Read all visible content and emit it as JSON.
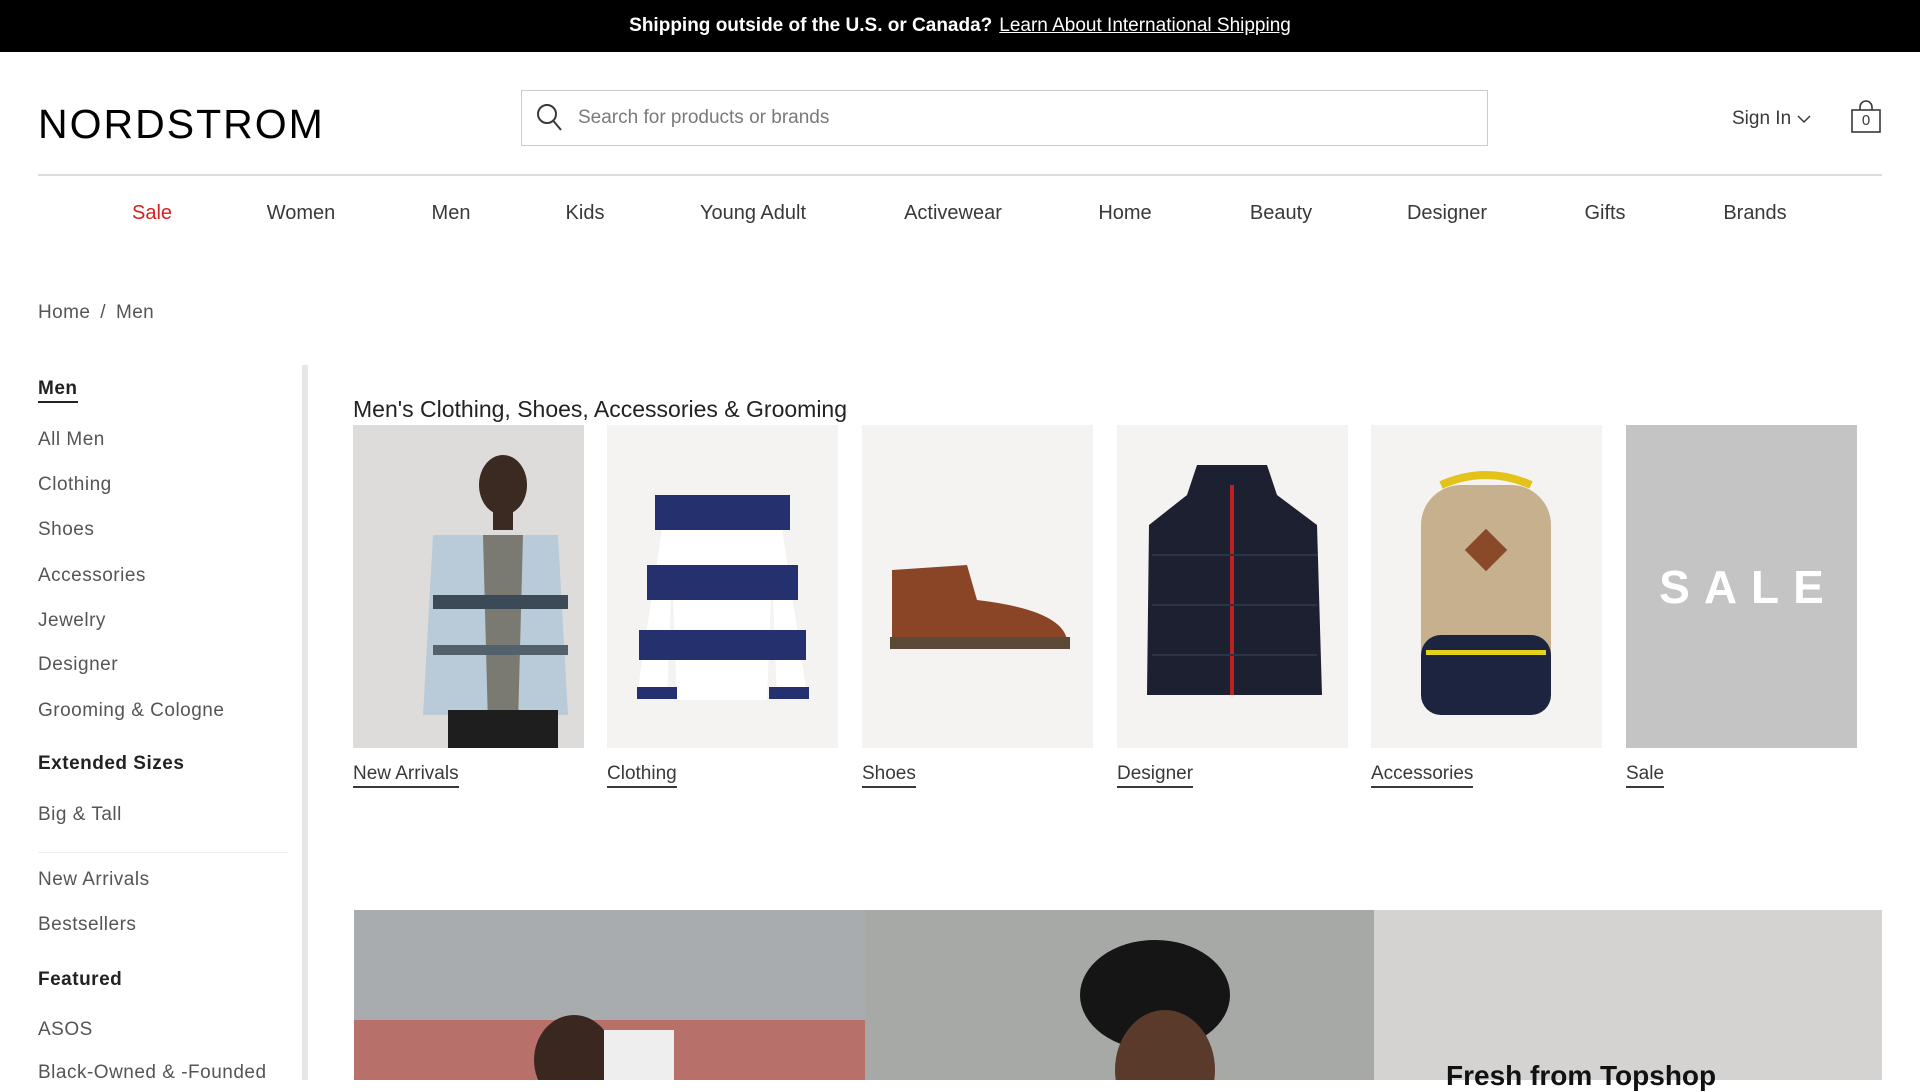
{
  "top_banner": {
    "text": "Shipping outside of the U.S. or Canada?",
    "link": "Learn About International Shipping"
  },
  "header": {
    "logo": "NORDSTROM",
    "search_placeholder": "Search for products or brands",
    "sign_in": "Sign In",
    "bag_count": "0",
    "icons": [
      "search-icon",
      "chevron-down-icon",
      "shopping-bag-icon"
    ]
  },
  "nav": [
    {
      "label": "Sale",
      "color": "#d6201f"
    },
    {
      "label": "Women"
    },
    {
      "label": "Men"
    },
    {
      "label": "Kids"
    },
    {
      "label": "Young Adult"
    },
    {
      "label": "Activewear"
    },
    {
      "label": "Home"
    },
    {
      "label": "Beauty"
    },
    {
      "label": "Designer"
    },
    {
      "label": "Gifts"
    },
    {
      "label": "Brands"
    }
  ],
  "breadcrumb": [
    "Home",
    "/",
    "Men"
  ],
  "sidebar": {
    "current": "Men",
    "items": [
      "All Men",
      "Clothing",
      "Shoes",
      "Accessories",
      "Jewelry",
      "Designer",
      "Grooming & Cologne"
    ],
    "extended_heading": "Extended Sizes",
    "extended_items": [
      "Big & Tall"
    ],
    "more_items": [
      "New Arrivals",
      "Bestsellers"
    ],
    "featured_heading": "Featured",
    "featured_items": [
      "ASOS",
      "Black-Owned & -Founded"
    ]
  },
  "main": {
    "heading": "Men's Clothing, Shoes, Accessories & Grooming",
    "tiles": [
      {
        "label": "New Arrivals"
      },
      {
        "label": "Clothing"
      },
      {
        "label": "Shoes"
      },
      {
        "label": "Designer"
      },
      {
        "label": "Accessories"
      },
      {
        "label": "Sale",
        "image_text": "SALE"
      }
    ],
    "promo_text": "Fresh from Topshop"
  }
}
